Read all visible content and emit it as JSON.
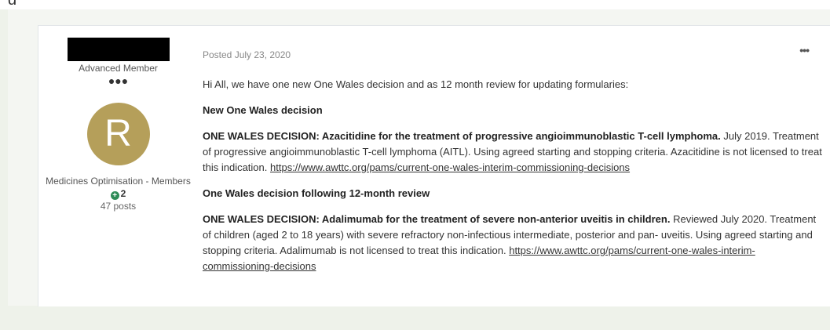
{
  "top_fragment": "g",
  "author": {
    "rank": "Advanced Member",
    "rank_dots": "●●●",
    "avatar_letter": "R",
    "avatar_color": "#b59f5a",
    "group": "Medicines Optimisation - Members",
    "reputation": "2",
    "posts": "47 posts"
  },
  "post": {
    "posted": "Posted July 23, 2020",
    "more_icon": "ellipsis-icon",
    "intro": "Hi All, we have one new One Wales decision and as 12 month review for updating formularies:",
    "section1_heading": "New One Wales decision",
    "decision1_title": "ONE WALES DECISION: Azacitidine for the treatment of progressive angioimmunoblastic T-cell lymphoma.",
    "decision1_body": "July 2019. Treatment of progressive angioimmunoblastic T-cell lymphoma (AITL). Using agreed starting and stopping criteria. Azacitidine is not licensed to treat this indication.",
    "decision1_link": "https://www.awttc.org/pams/current-one-wales-interim-commissioning-decisions",
    "section2_heading": "One Wales decision following 12-month review",
    "decision2_title": "ONE WALES DECISION: Adalimumab for the treatment of severe non-anterior uveitis in children.",
    "decision2_body": "Reviewed July 2020. Treatment of children (aged 2 to 18 years) with severe refractory non-infectious intermediate, posterior and pan- uveitis. Using agreed starting and stopping criteria. Adalimumab is not licensed to treat this indication.",
    "decision2_link": "https://www.awttc.org/pams/current-one-wales-interim-commissioning-decisions"
  }
}
